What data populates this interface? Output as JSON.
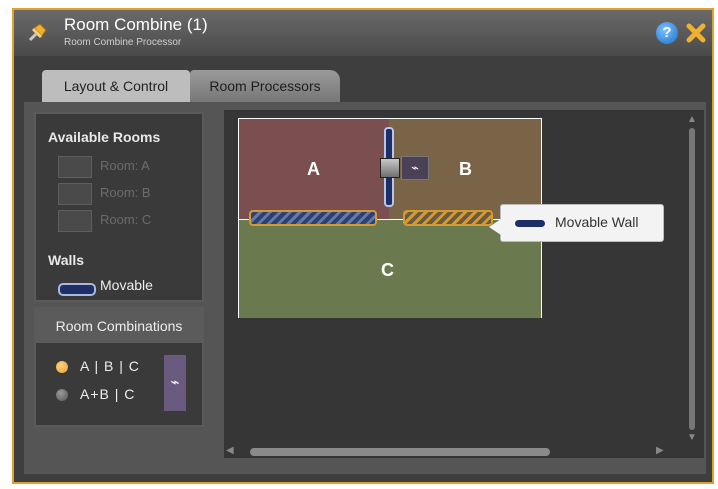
{
  "window": {
    "title": "Room Combine (1)",
    "subtitle": "Room Combine Processor",
    "help_icon": "help-icon",
    "close_icon": "close-icon",
    "pin_icon": "pushpin-icon"
  },
  "tabs": [
    {
      "label": "Layout & Control",
      "active": true
    },
    {
      "label": "Room Processors",
      "active": false
    }
  ],
  "available_rooms": {
    "title": "Available Rooms",
    "rooms": [
      "Room: A",
      "Room: B",
      "Room: C"
    ]
  },
  "walls": {
    "title": "Walls",
    "legend_label": "Movable"
  },
  "room_combinations": {
    "title": "Room Combinations",
    "options": [
      {
        "label": "A | B | C",
        "selected": true
      },
      {
        "label": "A+B | C",
        "selected": false
      }
    ],
    "link_icon": "link-icon"
  },
  "layout": {
    "rooms": [
      {
        "letter": "A",
        "color": "#7b4f4f"
      },
      {
        "letter": "B",
        "color": "#7a6448"
      },
      {
        "letter": "C",
        "color": "#6b7a4e"
      }
    ],
    "tooltip": "Movable Wall"
  },
  "colors": {
    "accent": "#e0a030",
    "wall": "#1d2f66",
    "radio_selected": "#e8a030",
    "radio_unselected": "#666666"
  }
}
